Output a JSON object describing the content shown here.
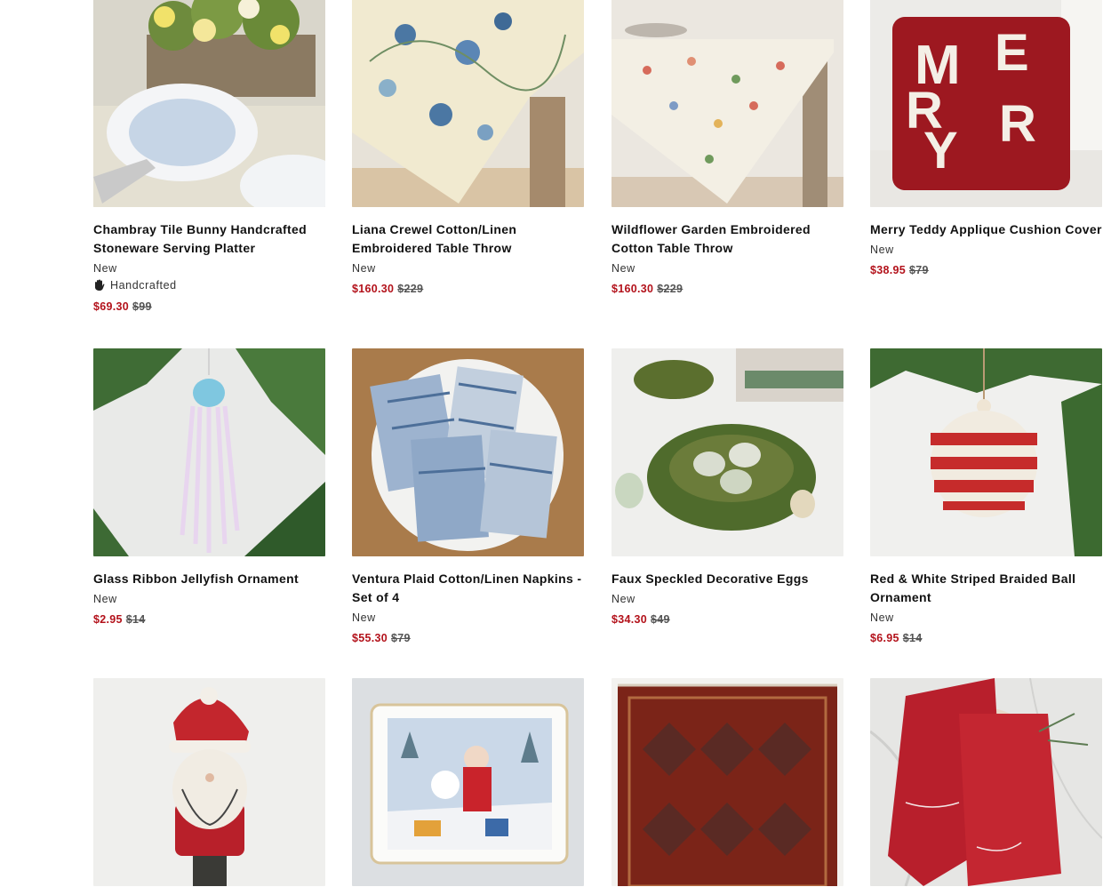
{
  "colors": {
    "sale": "#b3121b",
    "text": "#111111",
    "muted": "#555555"
  },
  "products": [
    {
      "title": "Chambray Tile Bunny Handcrafted Stoneware Serving Platter",
      "badge": "New",
      "feature": "Handcrafted",
      "feature_icon": "hand-icon",
      "sale_price": "$69.30",
      "original_price": "$99"
    },
    {
      "title": "Liana Crewel Cotton/Linen Embroidered Table Throw",
      "badge": "New",
      "sale_price": "$160.30",
      "original_price": "$229"
    },
    {
      "title": "Wildflower Garden Embroidered Cotton Table Throw",
      "badge": "New",
      "sale_price": "$160.30",
      "original_price": "$229"
    },
    {
      "title": "Merry Teddy Applique Cushion Cover",
      "badge": "New",
      "sale_price": "$38.95",
      "original_price": "$79"
    },
    {
      "title": "Glass Ribbon Jellyfish Ornament",
      "badge": "New",
      "sale_price": "$2.95",
      "original_price": "$14"
    },
    {
      "title": "Ventura Plaid Cotton/Linen Napkins - Set of 4",
      "badge": "New",
      "sale_price": "$55.30",
      "original_price": "$79"
    },
    {
      "title": "Faux Speckled Decorative Eggs",
      "badge": "New",
      "sale_price": "$34.30",
      "original_price": "$49"
    },
    {
      "title": "Red & White Striped Braided Ball Ornament",
      "badge": "New",
      "sale_price": "$6.95",
      "original_price": "$14"
    }
  ]
}
